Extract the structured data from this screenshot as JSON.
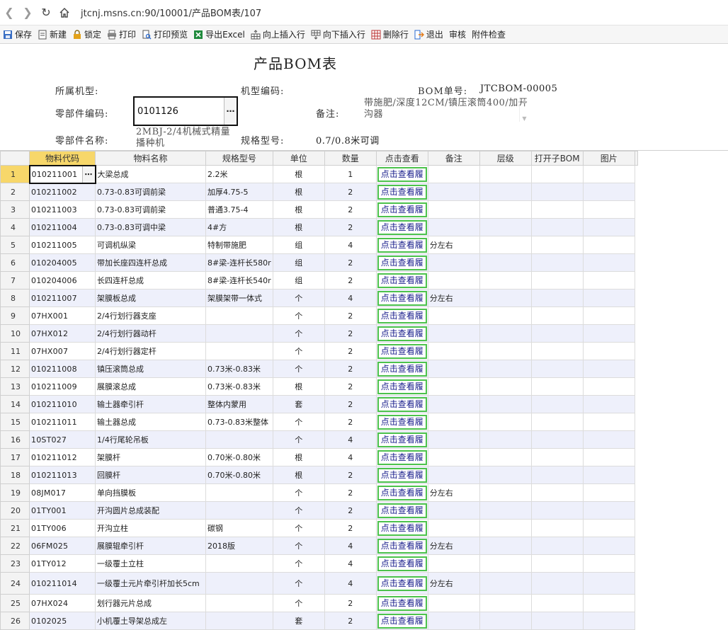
{
  "browser": {
    "url": "jtcnj.msns.cn:90/10001/产品BOM表/107"
  },
  "toolbar": [
    {
      "label": "保存",
      "icon": "save-icon"
    },
    {
      "label": "新建",
      "icon": "new-icon"
    },
    {
      "label": "锁定",
      "icon": "lock-icon"
    },
    {
      "label": "打印",
      "icon": "print-icon"
    },
    {
      "label": "打印预览",
      "icon": "print-preview-icon"
    },
    {
      "label": "导出Excel",
      "icon": "excel-icon"
    },
    {
      "label": "向上插入行",
      "icon": "insert-row-above-icon"
    },
    {
      "label": "向下插入行",
      "icon": "insert-row-below-icon"
    },
    {
      "label": "删除行",
      "icon": "delete-row-icon"
    },
    {
      "label": "退出",
      "icon": "exit-icon"
    },
    {
      "label": "审核",
      "icon": ""
    },
    {
      "label": "附件检查",
      "icon": ""
    }
  ],
  "form": {
    "title": "产品BOM表",
    "machine_type_label": "所属机型:",
    "machine_code_label": "机型编码:",
    "bom_no_label": "BOM单号:",
    "bom_no_value": "JTCBOM-00005",
    "part_code_label": "零部件编码:",
    "part_code_value": "0101126",
    "remark_label": "备注:",
    "remark_value": "带施肥/深度12CM/镇压滚筒400/加开沟器",
    "part_name_label": "零部件名称:",
    "part_name_value": "2MBJ-2/4机械式精量播种机",
    "spec_label": "规格型号:",
    "spec_value": "0.7/0.8米可调"
  },
  "grid": {
    "columns": [
      "物料代码",
      "物料名称",
      "规格型号",
      "单位",
      "数量",
      "点击查看",
      "备注",
      "层级",
      "打开子BOM",
      "图片"
    ],
    "view_button_label": "点击查看履",
    "rows": [
      {
        "n": "1",
        "code": "010211001",
        "name": "大梁总成",
        "spec": "2.2米",
        "unit": "根",
        "qty": "1",
        "note": ""
      },
      {
        "n": "2",
        "code": "010211002",
        "name": "0.73-0.83可调前梁",
        "spec": "加厚4.75-5",
        "unit": "根",
        "qty": "2",
        "note": ""
      },
      {
        "n": "3",
        "code": "010211003",
        "name": "0.73-0.83可调前梁",
        "spec": "普通3.75-4",
        "unit": "根",
        "qty": "2",
        "note": ""
      },
      {
        "n": "4",
        "code": "010211004",
        "name": "0.73-0.83可调中梁",
        "spec": "4#方",
        "unit": "根",
        "qty": "2",
        "note": ""
      },
      {
        "n": "5",
        "code": "010211005",
        "name": "可调机纵梁",
        "spec": "特制带施肥",
        "unit": "组",
        "qty": "4",
        "note": "分左右"
      },
      {
        "n": "6",
        "code": "010204005",
        "name": "带加长座四连杆总成",
        "spec": "8#梁-连杆长580r",
        "unit": "组",
        "qty": "2",
        "note": ""
      },
      {
        "n": "7",
        "code": "010204006",
        "name": "长四连杆总成",
        "spec": "8#梁-连杆长540r",
        "unit": "组",
        "qty": "2",
        "note": ""
      },
      {
        "n": "8",
        "code": "010211007",
        "name": "架膜板总成",
        "spec": "架膜架带一体式",
        "unit": "个",
        "qty": "4",
        "note": "分左右"
      },
      {
        "n": "9",
        "code": "07HX001",
        "name": "2/4行划行器支座",
        "spec": "",
        "unit": "个",
        "qty": "2",
        "note": ""
      },
      {
        "n": "10",
        "code": "07HX012",
        "name": "2/4行划行器动杆",
        "spec": "",
        "unit": "个",
        "qty": "2",
        "note": ""
      },
      {
        "n": "11",
        "code": "07HX007",
        "name": "2/4行划行器定杆",
        "spec": "",
        "unit": "个",
        "qty": "2",
        "note": ""
      },
      {
        "n": "12",
        "code": "010211008",
        "name": "镇压滚筒总成",
        "spec": "0.73米-0.83米",
        "unit": "个",
        "qty": "2",
        "note": ""
      },
      {
        "n": "13",
        "code": "010211009",
        "name": "展膜滚总成",
        "spec": "0.73米-0.83米",
        "unit": "根",
        "qty": "2",
        "note": ""
      },
      {
        "n": "14",
        "code": "010211010",
        "name": "输土器牵引杆",
        "spec": "整体内蒙用",
        "unit": "套",
        "qty": "2",
        "note": ""
      },
      {
        "n": "15",
        "code": "010211011",
        "name": "输土器总成",
        "spec": "0.73-0.83米整体",
        "unit": "个",
        "qty": "2",
        "note": ""
      },
      {
        "n": "16",
        "code": "10ST027",
        "name": "1/4行尾轮吊板",
        "spec": "",
        "unit": "个",
        "qty": "4",
        "note": ""
      },
      {
        "n": "17",
        "code": "010211012",
        "name": "架膜杆",
        "spec": "0.70米-0.80米",
        "unit": "根",
        "qty": "4",
        "note": ""
      },
      {
        "n": "18",
        "code": "010211013",
        "name": "回膜杆",
        "spec": "0.70米-0.80米",
        "unit": "根",
        "qty": "2",
        "note": ""
      },
      {
        "n": "19",
        "code": "08JM017",
        "name": "单向挡膜板",
        "spec": "",
        "unit": "个",
        "qty": "2",
        "note": "分左右"
      },
      {
        "n": "20",
        "code": "01TY001",
        "name": "开沟圆片总成装配",
        "spec": "",
        "unit": "个",
        "qty": "2",
        "note": ""
      },
      {
        "n": "21",
        "code": "01TY006",
        "name": "开沟立柱",
        "spec": "碳钢",
        "unit": "个",
        "qty": "2",
        "note": ""
      },
      {
        "n": "22",
        "code": "06FM025",
        "name": "展膜辊牵引杆",
        "spec": "2018版",
        "unit": "个",
        "qty": "4",
        "note": "分左右"
      },
      {
        "n": "23",
        "code": "01TY012",
        "name": "一级覆土立柱",
        "spec": "",
        "unit": "个",
        "qty": "4",
        "note": ""
      },
      {
        "n": "24",
        "code": "010211014",
        "name": "一级覆土元片牵引杆加长5cm",
        "spec": "",
        "unit": "个",
        "qty": "4",
        "note": "分左右"
      },
      {
        "n": "25",
        "code": "07HX024",
        "name": "划行器元片总成",
        "spec": "",
        "unit": "个",
        "qty": "2",
        "note": ""
      },
      {
        "n": "26",
        "code": "0102025",
        "name": "小机覆土导架总成左",
        "spec": "",
        "unit": "套",
        "qty": "2",
        "note": ""
      }
    ]
  }
}
